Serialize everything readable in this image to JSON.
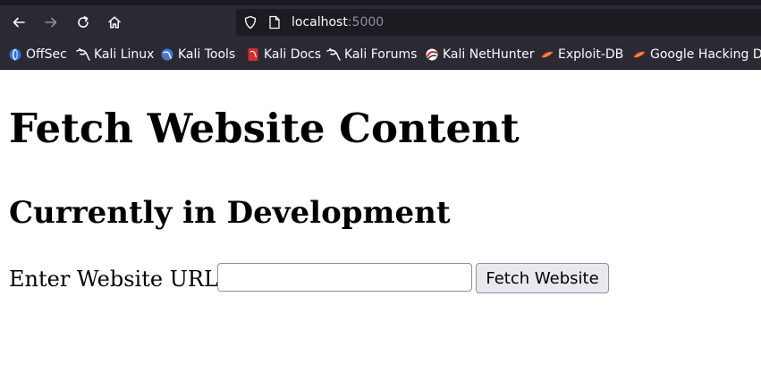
{
  "browser": {
    "url_host": "localhost",
    "url_port": ":5000",
    "nav": {
      "back": "back-arrow-icon",
      "forward": "forward-arrow-icon",
      "reload": "reload-icon",
      "home": "home-icon"
    },
    "bookmarks": [
      {
        "label": "OffSec",
        "icon": "offsec-icon"
      },
      {
        "label": "Kali Linux",
        "icon": "kali-dragon-icon"
      },
      {
        "label": "Kali Tools",
        "icon": "kali-tools-icon"
      },
      {
        "label": "Kali Docs",
        "icon": "kali-docs-icon"
      },
      {
        "label": "Kali Forums",
        "icon": "kali-dragon-icon"
      },
      {
        "label": "Kali NetHunter",
        "icon": "nethunter-icon"
      },
      {
        "label": "Exploit-DB",
        "icon": "exploit-db-icon"
      },
      {
        "label": "Google Hacking DB",
        "icon": "exploit-db-icon"
      }
    ],
    "colors": {
      "toolbar_bg": "#2b2a33",
      "urlbar_bg": "#1c1b22",
      "text": "#fbfbfe",
      "muted": "#8f8f9d"
    }
  },
  "page": {
    "title": "Fetch Website Content",
    "subtitle": "Currently in Development",
    "form": {
      "label": "Enter Website URL:",
      "input_value": "",
      "button_label": "Fetch Website"
    }
  }
}
